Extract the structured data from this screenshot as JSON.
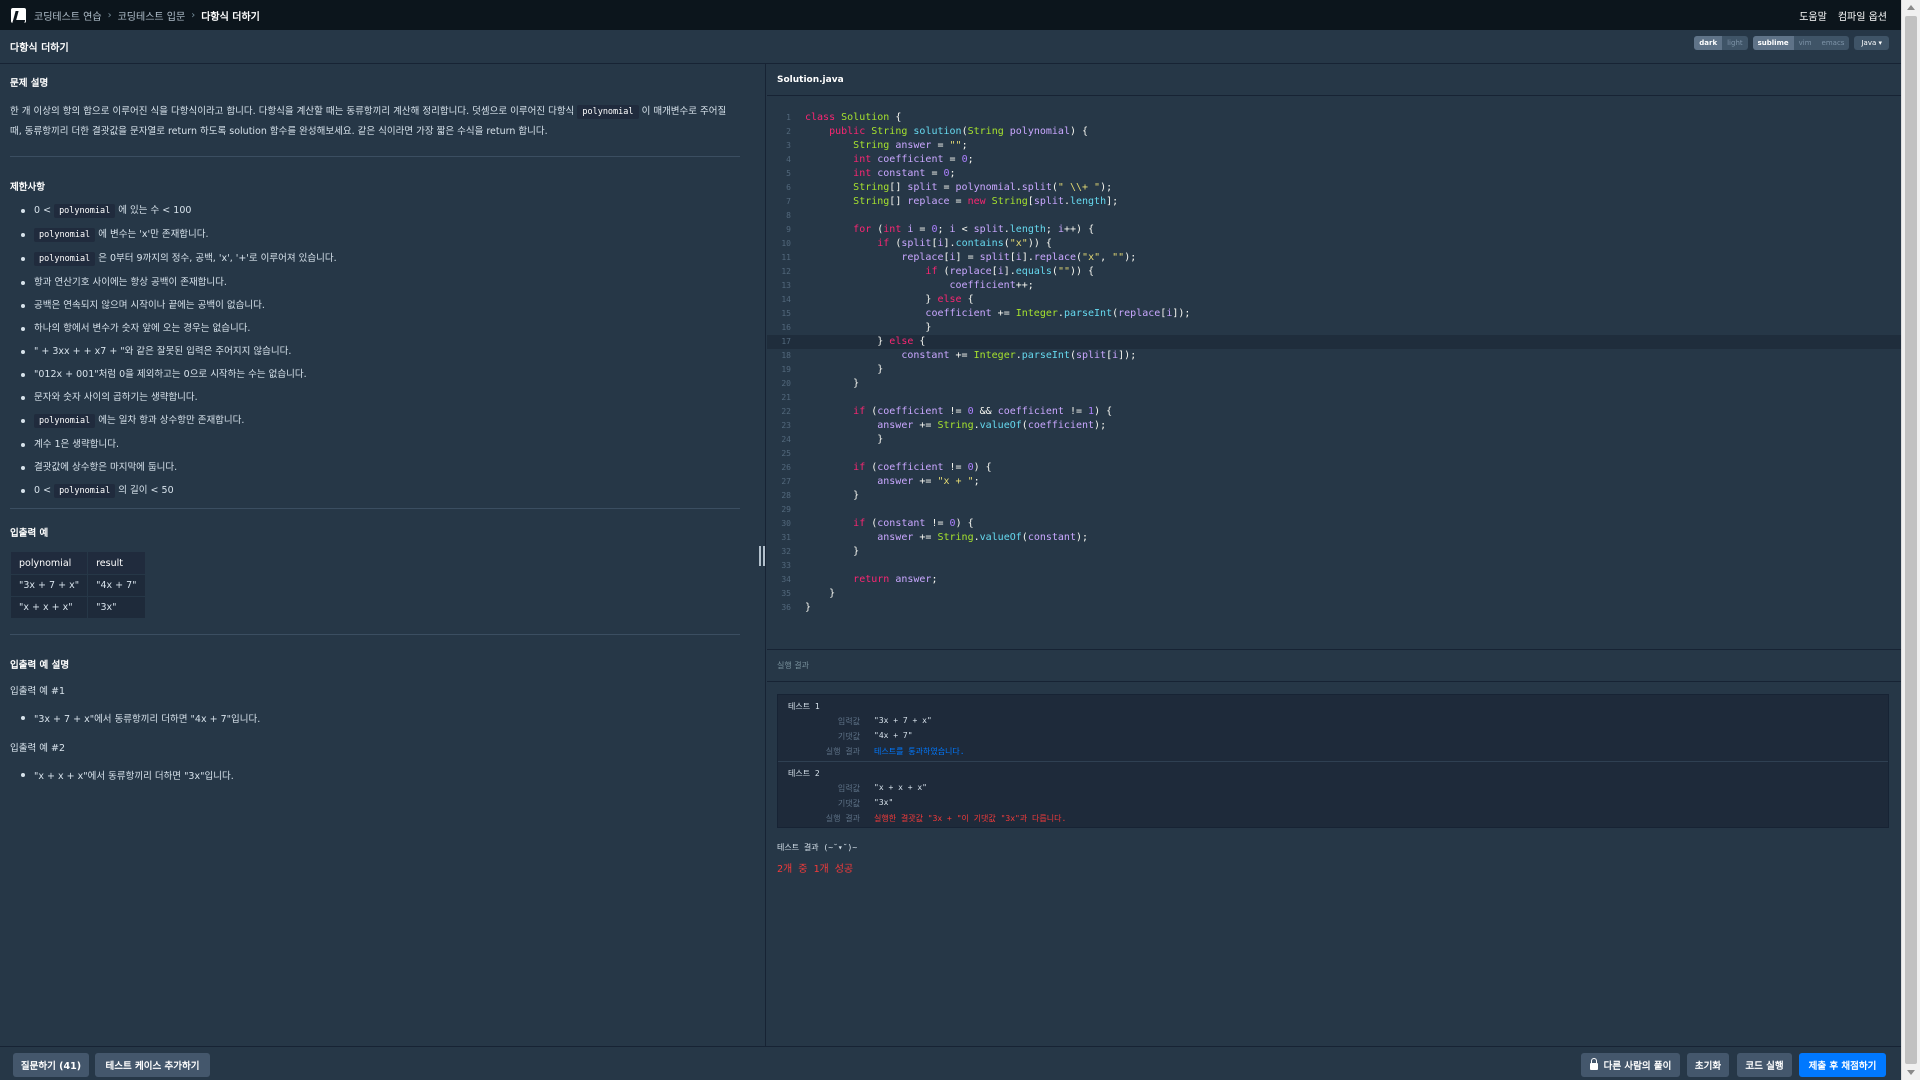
{
  "nav": {
    "breadcrumbs": [
      "코딩테스트 연습",
      "코딩테스트 입문",
      "다항식 더하기"
    ],
    "help": "도움말",
    "compile_options": "컴파일 옵션"
  },
  "title": "다항식 더하기",
  "toolbar": {
    "themes": [
      "dark",
      "light"
    ],
    "active_theme": "dark",
    "keymaps": [
      "sublime",
      "vim",
      "emacs"
    ],
    "active_keymap": "sublime",
    "language": "Java ▾"
  },
  "problem": {
    "desc_heading": "문제 설명",
    "desc_part1": "한 개 이상의 항의 합으로 이루어진 식을 다항식이라고 합니다. 다항식을 계산할 때는 동류항끼리 계산해 정리합니다. 덧셈으로 이루어진 다항식",
    "desc_code": "polynomial",
    "desc_part2": "이 매개변수로 주어질 때, 동류항끼리 더한 결괏값을 문자열로 return 하도록 solution 함수를 완성해보세요. 같은 식이라면 가장 짧은 수식을 return 합니다.",
    "limits_heading": "제한사항",
    "limits": [
      {
        "pre": "0 <",
        "code": "polynomial",
        "post": "에 있는 수 < 100"
      },
      {
        "pre": "",
        "code": "polynomial",
        "post": "에 변수는 'x'만 존재합니다."
      },
      {
        "pre": "",
        "code": "polynomial",
        "post": "은 0부터 9까지의 정수, 공백, 'x', '+'로 이루어져 있습니다."
      },
      {
        "pre": "항과 연산기호 사이에는 항상 공백이 존재합니다.",
        "code": "",
        "post": ""
      },
      {
        "pre": "공백은 연속되지 않으며 시작이나 끝에는 공백이 없습니다.",
        "code": "",
        "post": ""
      },
      {
        "pre": "하나의 항에서 변수가 숫자 앞에 오는 경우는 없습니다.",
        "code": "",
        "post": ""
      },
      {
        "pre": "\" + 3xx + + x7 + \"와 같은 잘못된 입력은 주어지지 않습니다.",
        "code": "",
        "post": ""
      },
      {
        "pre": "\"012x + 001\"처럼 0을 제외하고는 0으로 시작하는 수는 없습니다.",
        "code": "",
        "post": ""
      },
      {
        "pre": "문자와 숫자 사이의 곱하기는 생략합니다.",
        "code": "",
        "post": ""
      },
      {
        "pre": "",
        "code": "polynomial",
        "post": "에는 일차 항과 상수항만 존재합니다."
      },
      {
        "pre": "계수 1은 생략합니다.",
        "code": "",
        "post": ""
      },
      {
        "pre": "결괏값에 상수항은 마지막에 둡니다.",
        "code": "",
        "post": ""
      },
      {
        "pre": "0 <",
        "code": "polynomial",
        "post": "의 길이 < 50"
      }
    ],
    "io_heading": "입출력 예",
    "io_headers": [
      "polynomial",
      "result"
    ],
    "io_rows": [
      [
        "\"3x + 7 + x\"",
        "\"4x + 7\""
      ],
      [
        "\"x + x + x\"",
        "\"3x\""
      ]
    ],
    "io_explain_heading": "입출력 예 설명",
    "explanations": [
      {
        "label": "입출력 예 #1",
        "text": "\"3x + 7 + x\"에서 동류항끼리 더하면 \"4x + 7\"입니다."
      },
      {
        "label": "입출력 예 #2",
        "text": "\"x + x + x\"에서 동류항끼리 더하면 \"3x\"입니다."
      }
    ]
  },
  "editor": {
    "filename": "Solution.java",
    "active_line": 17,
    "lines": [
      "class Solution {",
      "    public String solution(String polynomial) {",
      "        String answer = \"\";",
      "        int coefficient = 0;",
      "        int constant = 0;",
      "        String[] split = polynomial.split(\" \\\\+ \");",
      "        String[] replace = new String[split.length];",
      "",
      "        for (int i = 0; i < split.length; i++) {",
      "            if (split[i].contains(\"x\")) {",
      "                replace[i] = split[i].replace(\"x\", \"\");",
      "                    if (replace[i].equals(\"\")) {",
      "                        coefficient++;",
      "                    } else {",
      "                    coefficient += Integer.parseInt(replace[i]);",
      "                    }",
      "            } else {",
      "                constant += Integer.parseInt(split[i]);",
      "            }",
      "        }",
      "",
      "        if (coefficient != 0 && coefficient != 1) {",
      "            answer += String.valueOf(coefficient);",
      "            }",
      "",
      "        if (coefficient != 0) {",
      "            answer += \"x + \";",
      "        }",
      "",
      "        if (constant != 0) {",
      "            answer += String.valueOf(constant);",
      "        }",
      "",
      "        return answer;",
      "    }",
      "}"
    ]
  },
  "results": {
    "heading": "실행 결과",
    "labels": {
      "param": "입력값",
      "expected": "기댓값",
      "result": "실행 결과"
    },
    "tests": [
      {
        "title": "테스트 1",
        "param": "\"3x + 7 + x\"",
        "expected": "\"4x + 7\"",
        "result": "테스트를 통과하였습니다.",
        "passed": true
      },
      {
        "title": "테스트 2",
        "param": "\"x + x + x\"",
        "expected": "\"3x\"",
        "result": "실행한 결괏값 \"3x + \"이 기댓값 \"3x\"과 다릅니다.",
        "passed": false
      }
    ],
    "summary_label": "테스트 결과 (~˘▾˘)~",
    "summary_score": "2개 중 1개 성공"
  },
  "bottom": {
    "questions": "질문하기 (41)",
    "add_test": "테스트 케이스 추가하기",
    "others": "다른 사람의 풀이",
    "reset": "초기화",
    "run": "코드 실행",
    "submit": "제출 후 채점하기"
  },
  "colors": {
    "background": "#263747",
    "nav": "#0c151c",
    "primary": "#0078ff",
    "fail": "#f33a3a"
  }
}
